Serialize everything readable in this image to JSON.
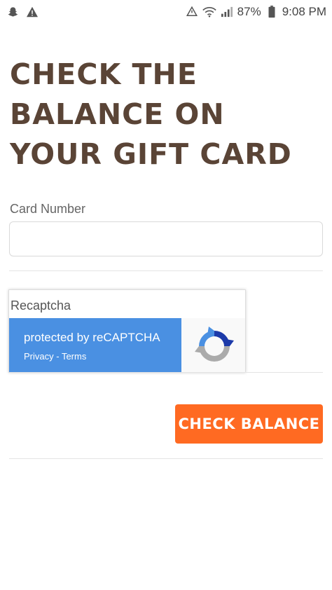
{
  "status_bar": {
    "left_icons": [
      "snapchat-icon",
      "warning-icon"
    ],
    "right_icons": [
      "sync-icon",
      "wifi-icon",
      "signal-icon"
    ],
    "battery_percent": "87%",
    "time": "9:08 PM"
  },
  "page": {
    "title": "CHECK THE BALANCE ON YOUR GIFT CARD"
  },
  "form": {
    "card_number_label": "Card Number",
    "card_number_value": "",
    "card_number_placeholder": ""
  },
  "recaptcha": {
    "label": "Recaptcha",
    "protected_text": "protected by reCAPTCHA",
    "privacy_link": "Privacy",
    "separator": " - ",
    "terms_link": "Terms"
  },
  "actions": {
    "check_balance_label": "CHECK BALANCE"
  },
  "colors": {
    "title": "#5a4436",
    "button": "#ff6a22",
    "recaptcha_blue": "#4a90e2"
  }
}
